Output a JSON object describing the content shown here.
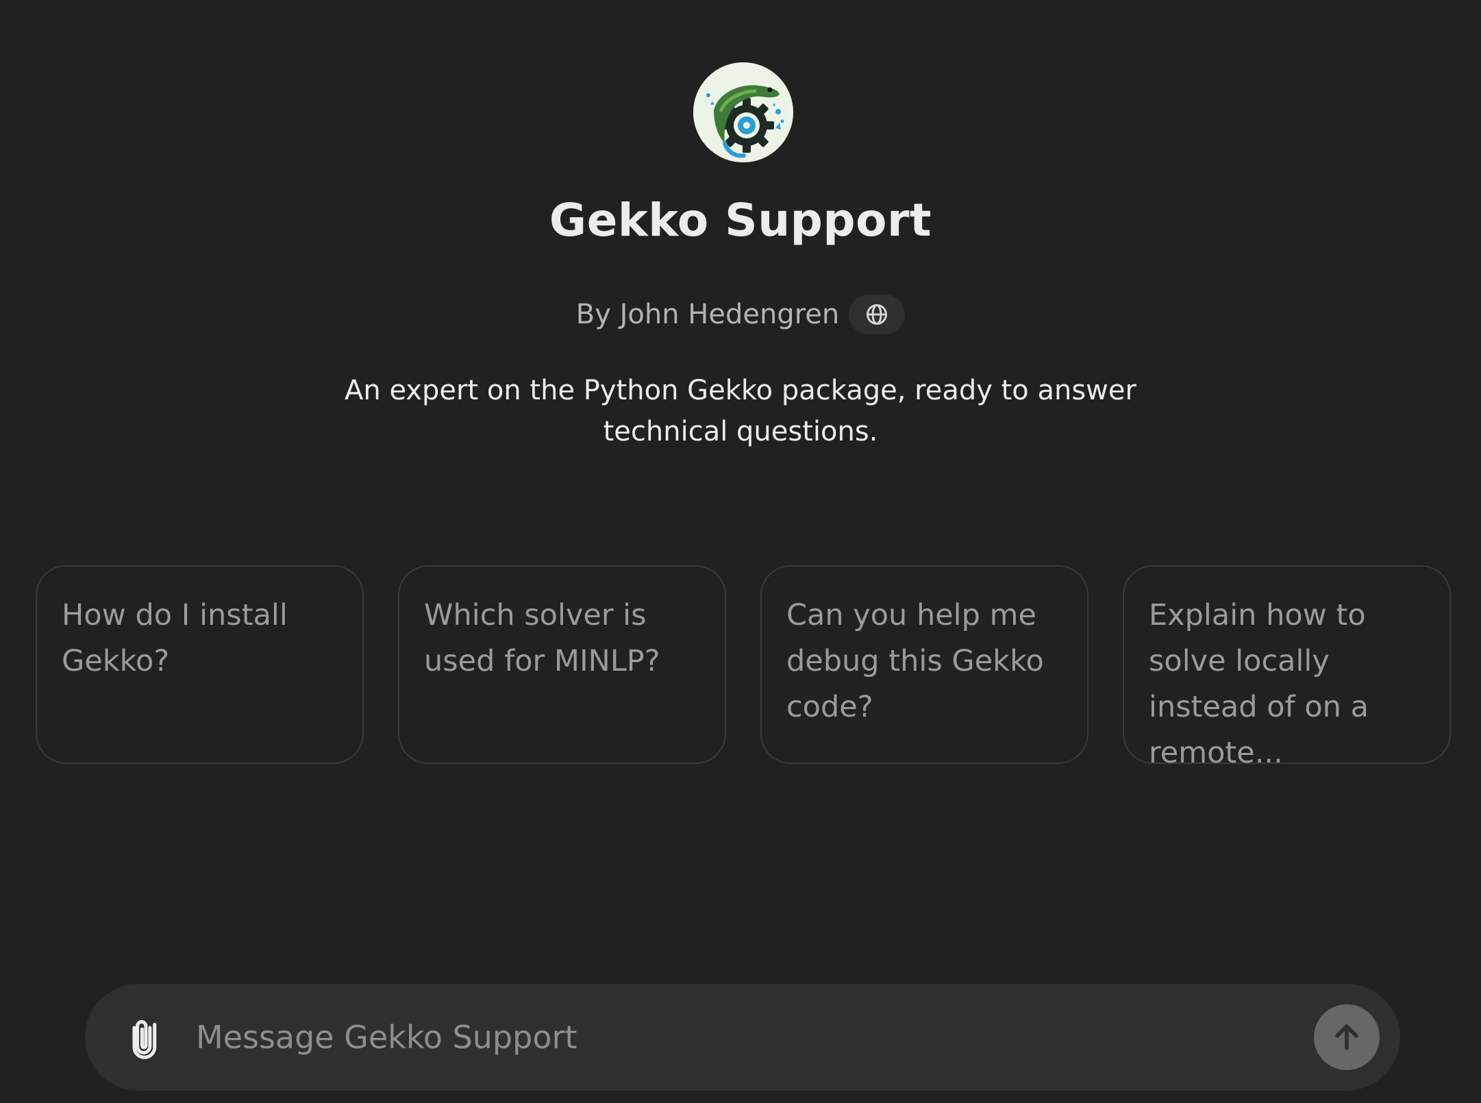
{
  "gpt": {
    "name": "Gekko Support",
    "byline": "By John Hedengren",
    "description": "An expert on the Python Gekko package, ready to answer technical questions.",
    "avatar_icon": "gecko-on-gear-logo",
    "website_icon": "globe-icon"
  },
  "starters": [
    {
      "label": "How do I install Gekko?"
    },
    {
      "label": "Which solver is used for MINLP?"
    },
    {
      "label": "Can you help me debug this Gekko code?"
    },
    {
      "label": "Explain how to solve locally instead of on a remote..."
    }
  ],
  "composer": {
    "placeholder": "Message Gekko Support",
    "attach_icon": "paperclip-icon",
    "send_icon": "arrow-up-icon"
  },
  "colors": {
    "background": "#212121",
    "composer": "#2f2f2f",
    "card_border": "#3a3a3a",
    "send_button": "#676767",
    "text_primary": "#ececec",
    "text_secondary": "#b4b4b4"
  }
}
